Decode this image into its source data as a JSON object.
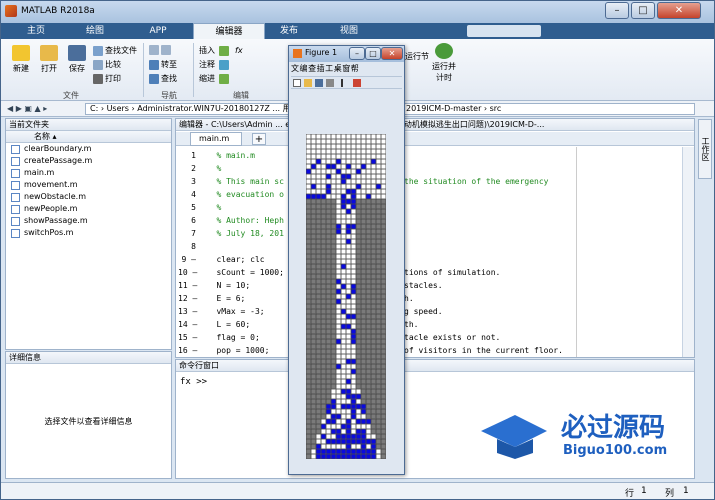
{
  "window": {
    "title": "MATLAB R2018a",
    "min": "–",
    "max": "□",
    "close": "✕"
  },
  "tabs": [
    "主页",
    "绘图",
    "APP",
    "编辑器",
    "发布",
    "视图"
  ],
  "search": {
    "placeholder": "搜索文档"
  },
  "ribbon": {
    "file": {
      "new": "新建",
      "open": "打开",
      "save": "保存",
      "find_files": "查找文件",
      "compare": "比较",
      "print": "打印",
      "group": "文件"
    },
    "nav": {
      "goto": "转至",
      "find": "查找",
      "group": "导航"
    },
    "edit": {
      "insert": "插入",
      "comment": "注释",
      "indent": "缩进",
      "fx": "fx",
      "group": "编辑"
    },
    "run": {
      "run_section": "运行节",
      "run_time": "运行并\n计时"
    }
  },
  "address": {
    "path": "C: › Users › Administrator.WIN7U-20180127Z ...  用元胞自动机模拟逃生出口问题) › 2019ICM-D-master › src"
  },
  "current_folder": {
    "title": "当前文件夹",
    "col": "名称 ▴",
    "files": [
      "clearBoundary.m",
      "createPassage.m",
      "main.m",
      "movement.m",
      "newObstacle.m",
      "newPeople.m",
      "showPassage.m",
      "switchPos.m"
    ]
  },
  "details": {
    "title": "详细信息",
    "hint": "选择文件以查看详细信息"
  },
  "editor": {
    "title": "编辑器 - C:\\Users\\Admin ... esktop\\2019 美赛D题_用元胞自动机模拟逃生出口问题)\\2019ICM-D-...",
    "tab": "main.m",
    "add": "+",
    "lines": [
      {
        "n": "1",
        "l": "   % main.m",
        "r": ""
      },
      {
        "n": "2",
        "l": "   %",
        "r": ""
      },
      {
        "n": "3",
        "l": "   % This main sc",
        "r": "the situation of the emergency"
      },
      {
        "n": "4",
        "l": "   % evacuation o",
        "r": ""
      },
      {
        "n": "5",
        "l": "   %",
        "r": ""
      },
      {
        "n": "6",
        "l": "   % Author: Heph",
        "r": ""
      },
      {
        "n": "7",
        "l": "   % July 18, 201",
        "r": ""
      },
      {
        "n": "8",
        "l": "",
        "r": ""
      },
      {
        "n": "9 –",
        "l": "   clear; clc",
        "r": ""
      },
      {
        "n": "10 –",
        "l": "   sCount = 1000;",
        "r": "tions of simulation."
      },
      {
        "n": "11 –",
        "l": "   N = 10;",
        "r": "stacles."
      },
      {
        "n": "12 –",
        "l": "   E = 6;",
        "r": "h."
      },
      {
        "n": "13 –",
        "l": "   vMax = -3;",
        "r": "g speed."
      },
      {
        "n": "14 –",
        "l": "   L = 60;",
        "r": "th."
      },
      {
        "n": "15 –",
        "l": "   flag = 0;",
        "r": "tacle exists or not."
      },
      {
        "n": "16 –",
        "l": "   pop = 1000;",
        "r": "of visitors in the current floor."
      }
    ]
  },
  "command": {
    "title": "命令行窗口",
    "prompt": "fx >>"
  },
  "figure": {
    "title": "Figure 1",
    "menu": "文 编 查 插 工 桌 窗 帮"
  },
  "statusbar": {
    "row_label": "行",
    "row": "1",
    "col_label": "列",
    "col": "1"
  },
  "watermark": {
    "title": "必过源码",
    "url": "Biguo100.com"
  },
  "right_tab": "工作区"
}
